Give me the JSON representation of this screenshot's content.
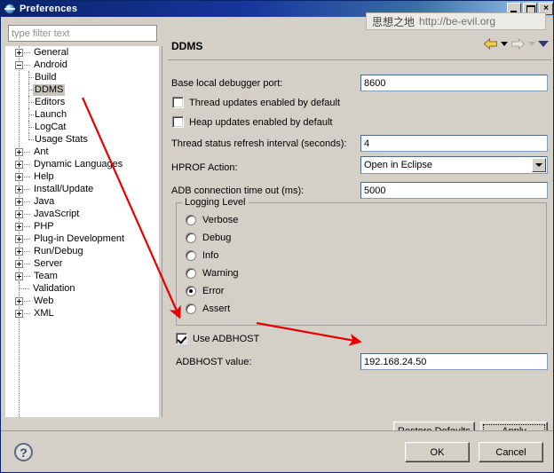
{
  "window": {
    "title": "Preferences",
    "icon": "eclipse-globe-icon",
    "buttons": {
      "minimize": "minimize-icon",
      "maximize": "maximize-icon",
      "close": "×"
    }
  },
  "watermark": {
    "chinese": "思想之地",
    "url": "http://be-evil.org"
  },
  "sidebar": {
    "filter_placeholder": "type filter text",
    "filter_value": "",
    "items": [
      {
        "label": "General",
        "level": 0,
        "state": "collapsed",
        "selected": false
      },
      {
        "label": "Android",
        "level": 0,
        "state": "expanded",
        "selected": false
      },
      {
        "label": "Build",
        "level": 1,
        "state": "leaf",
        "selected": false
      },
      {
        "label": "DDMS",
        "level": 1,
        "state": "leaf",
        "selected": true
      },
      {
        "label": "Editors",
        "level": 1,
        "state": "leaf",
        "selected": false
      },
      {
        "label": "Launch",
        "level": 1,
        "state": "leaf",
        "selected": false
      },
      {
        "label": "LogCat",
        "level": 1,
        "state": "leaf",
        "selected": false
      },
      {
        "label": "Usage Stats",
        "level": 1,
        "state": "leaf-last",
        "selected": false
      },
      {
        "label": "Ant",
        "level": 0,
        "state": "collapsed",
        "selected": false
      },
      {
        "label": "Dynamic Languages",
        "level": 0,
        "state": "collapsed",
        "selected": false
      },
      {
        "label": "Help",
        "level": 0,
        "state": "collapsed",
        "selected": false
      },
      {
        "label": "Install/Update",
        "level": 0,
        "state": "collapsed",
        "selected": false
      },
      {
        "label": "Java",
        "level": 0,
        "state": "collapsed",
        "selected": false
      },
      {
        "label": "JavaScript",
        "level": 0,
        "state": "collapsed",
        "selected": false
      },
      {
        "label": "PHP",
        "level": 0,
        "state": "collapsed",
        "selected": false
      },
      {
        "label": "Plug-in Development",
        "level": 0,
        "state": "collapsed",
        "selected": false
      },
      {
        "label": "Run/Debug",
        "level": 0,
        "state": "collapsed",
        "selected": false
      },
      {
        "label": "Server",
        "level": 0,
        "state": "collapsed",
        "selected": false
      },
      {
        "label": "Team",
        "level": 0,
        "state": "collapsed",
        "selected": false
      },
      {
        "label": "Validation",
        "level": 0,
        "state": "leaf",
        "selected": false
      },
      {
        "label": "Web",
        "level": 0,
        "state": "collapsed",
        "selected": false
      },
      {
        "label": "XML",
        "level": 0,
        "state": "collapsed",
        "selected": false
      }
    ]
  },
  "pane": {
    "title": "DDMS",
    "nav": {
      "back": "back-arrow-icon",
      "back_menu": "chevron-down-icon",
      "forward": "forward-arrow-icon",
      "forward_menu": "chevron-down-icon",
      "more": "chevron-down-icon"
    },
    "fields": {
      "base_port_label": "Base local debugger port:",
      "base_port_value": "8600",
      "thread_updates_label": "Thread updates enabled by default",
      "thread_updates_checked": false,
      "heap_updates_label": "Heap updates enabled by default",
      "heap_updates_checked": false,
      "refresh_label": "Thread status refresh interval (seconds):",
      "refresh_value": "4",
      "hprof_label": "HPROF Action:",
      "hprof_value": "Open in Eclipse",
      "adb_timeout_label": "ADB connection time out (ms):",
      "adb_timeout_value": "5000",
      "use_adbhost_label": "Use ADBHOST",
      "use_adbhost_checked": true,
      "adbhost_label": "ADBHOST value:",
      "adbhost_value": "192.168.24.50"
    },
    "logging": {
      "legend": "Logging Level",
      "options": [
        {
          "label": "Verbose",
          "selected": false
        },
        {
          "label": "Debug",
          "selected": false
        },
        {
          "label": "Info",
          "selected": false
        },
        {
          "label": "Warning",
          "selected": false
        },
        {
          "label": "Error",
          "selected": true
        },
        {
          "label": "Assert",
          "selected": false
        }
      ]
    },
    "buttons": {
      "restore_defaults": "Restore Defaults",
      "restore_defaults_mnemonic": "D",
      "apply": "Apply",
      "apply_mnemonic": "A"
    }
  },
  "footer": {
    "help": "?",
    "ok": "OK",
    "cancel": "Cancel"
  },
  "colors": {
    "title_bar_start": "#0a246a",
    "title_bar_end": "#a6caf0",
    "dialog_background": "#d4d0c8",
    "annotation_red": "#e60000",
    "selection": "#c8c4bc",
    "back_arrow": "#e8c43c"
  }
}
